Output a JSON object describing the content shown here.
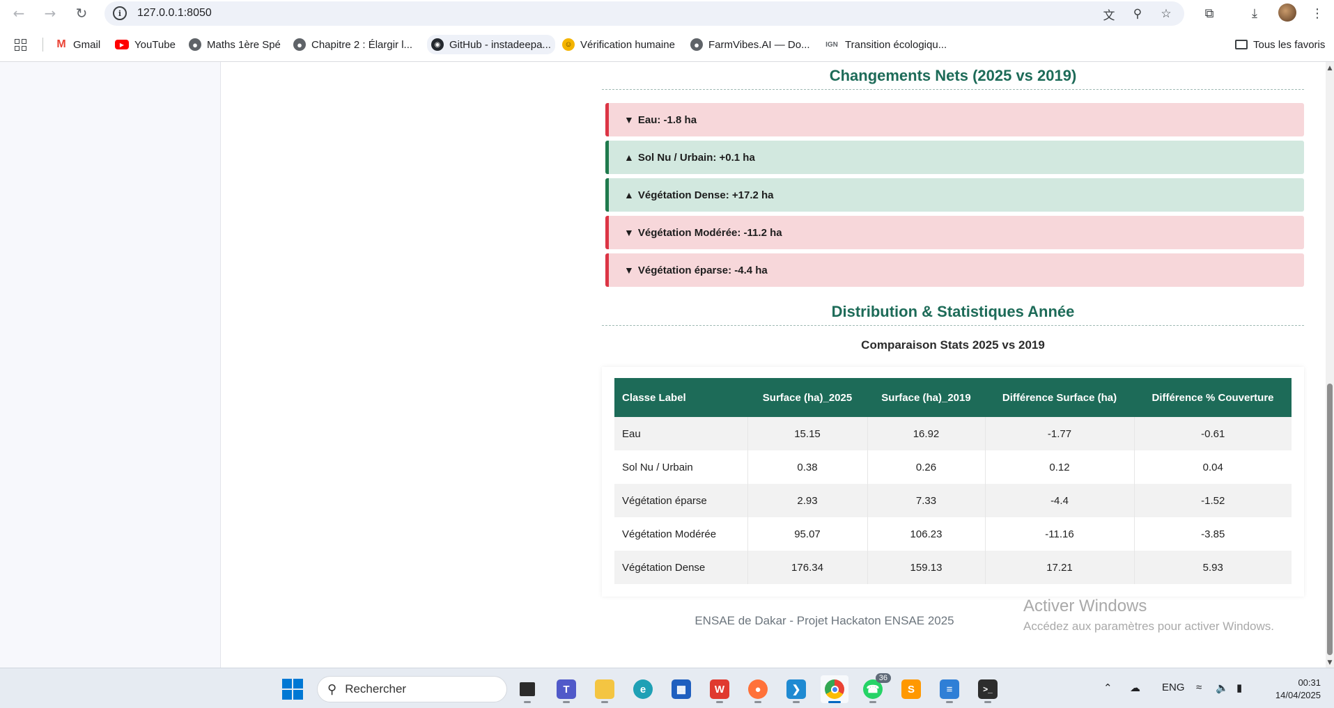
{
  "browser": {
    "url": "127.0.0.1:8050",
    "bookmarks": [
      {
        "label": "Gmail",
        "icon": "gmail-icon",
        "color": "#ea4335"
      },
      {
        "label": "YouTube",
        "icon": "youtube-icon",
        "color": "#ff0000"
      },
      {
        "label": "Maths 1ère Spé",
        "icon": "globe-icon",
        "color": "#5f6368"
      },
      {
        "label": "Chapitre 2 : Élargir l...",
        "icon": "globe-icon",
        "color": "#5f6368"
      },
      {
        "label": "GitHub - instadeepa...",
        "icon": "github-icon",
        "color": "#24292f"
      },
      {
        "label": "Vérification humaine",
        "icon": "emoji-icon",
        "color": "#f4b400"
      },
      {
        "label": "FarmVibes.AI — Do...",
        "icon": "globe-icon",
        "color": "#5f6368"
      },
      {
        "label": "Transition écologiqu...",
        "icon": "ign-icon",
        "color": "#5f6368"
      }
    ],
    "all_favorites": "Tous les favoris",
    "ign_glyph": "IGN"
  },
  "changes": {
    "title": "Changements Nets (2025 vs 2019)",
    "items": [
      {
        "direction": "down",
        "arrow": "▼",
        "text": "Eau: -1.8 ha"
      },
      {
        "direction": "up",
        "arrow": "▲",
        "text": "Sol Nu / Urbain: +0.1 ha"
      },
      {
        "direction": "up",
        "arrow": "▲",
        "text": "Végétation Dense: +17.2 ha"
      },
      {
        "direction": "down",
        "arrow": "▼",
        "text": "Végétation Modérée: -11.2 ha"
      },
      {
        "direction": "down",
        "arrow": "▼",
        "text": "Végétation éparse: -4.4 ha"
      }
    ]
  },
  "distribution": {
    "title": "Distribution & Statistiques Année",
    "table_caption": "Comparaison Stats 2025 vs 2019",
    "columns": [
      "Classe Label",
      "Surface (ha)_2025",
      "Surface (ha)_2019",
      "Différence Surface (ha)",
      "Différence % Couverture"
    ],
    "rows": [
      [
        "Eau",
        "15.15",
        "16.92",
        "-1.77",
        "-0.61"
      ],
      [
        "Sol Nu / Urbain",
        "0.38",
        "0.26",
        "0.12",
        "0.04"
      ],
      [
        "Végétation éparse",
        "2.93",
        "7.33",
        "-4.4",
        "-1.52"
      ],
      [
        "Végétation Modérée",
        "95.07",
        "106.23",
        "-11.16",
        "-3.85"
      ],
      [
        "Végétation Dense",
        "176.34",
        "159.13",
        "17.21",
        "5.93"
      ]
    ]
  },
  "footer": "ENSAE de Dakar - Projet Hackaton ENSAE 2025",
  "watermark": {
    "title": "Activer Windows",
    "subtitle": "Accédez aux paramètres pour activer Windows."
  },
  "taskbar": {
    "search_placeholder": "Rechercher",
    "whatsapp_badge": "36",
    "language": "ENG",
    "time": "00:31",
    "date": "14/04/2025"
  },
  "colors": {
    "accent": "#1d6b58",
    "negative_bg": "#f7d7da",
    "negative_border": "#dc3545",
    "positive_bg": "#d2e8df",
    "positive_border": "#1f7a4d"
  }
}
